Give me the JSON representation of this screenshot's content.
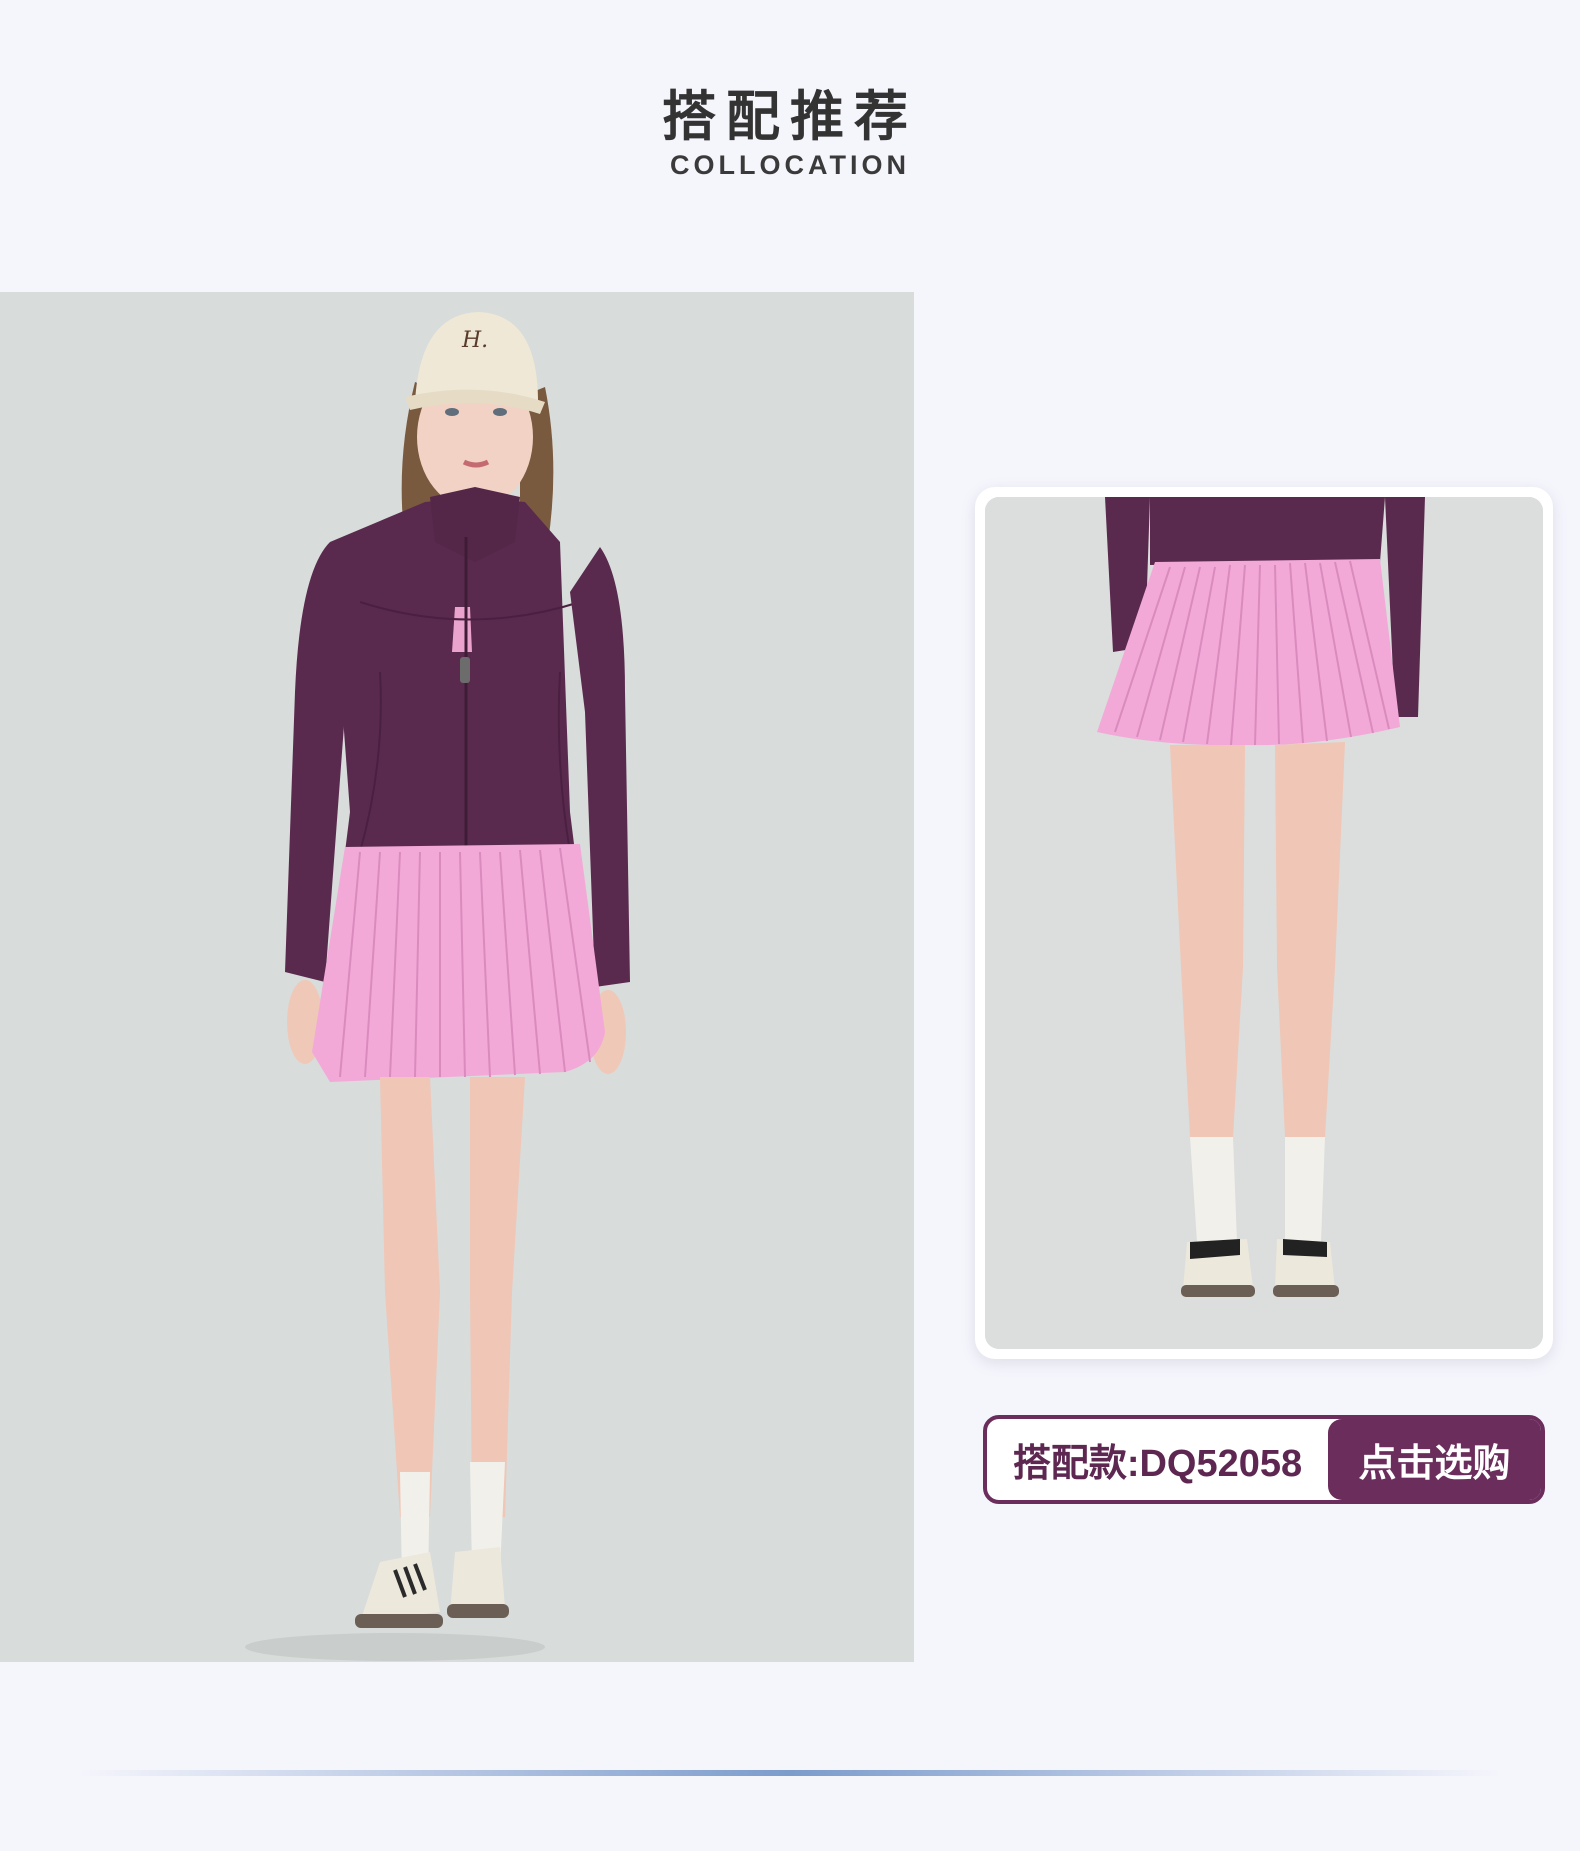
{
  "header": {
    "title": "搭配推荐",
    "subtitle": "COLLOCATION"
  },
  "main_photo": {
    "cap_logo_text": "H."
  },
  "detail_photo": {},
  "buy_bar": {
    "code_label": "搭配款:DQ52058",
    "button_label": "点击选购"
  },
  "colors": {
    "accent": "#6b2d5c",
    "jacket": "#5a2a4e",
    "skirt": "#f2a9d8",
    "background": "#f5f5fc"
  }
}
